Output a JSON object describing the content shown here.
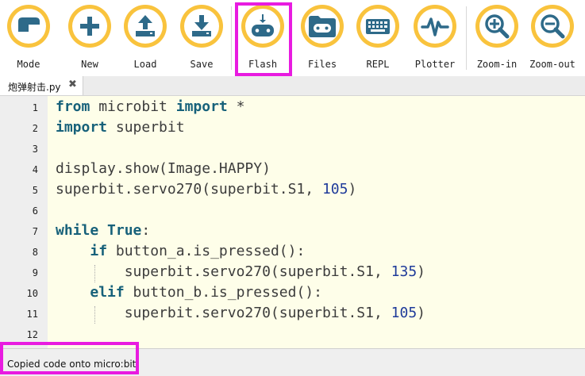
{
  "toolbar": {
    "buttons": [
      {
        "label": "Mode",
        "icon": "mode-icon"
      },
      {
        "label": "New",
        "icon": "plus-icon"
      },
      {
        "label": "Load",
        "icon": "upload-icon"
      },
      {
        "label": "Save",
        "icon": "download-icon"
      },
      {
        "label": "Flash",
        "icon": "flash-icon"
      },
      {
        "label": "Files",
        "icon": "files-icon"
      },
      {
        "label": "REPL",
        "icon": "keyboard-icon"
      },
      {
        "label": "Plotter",
        "icon": "plotter-icon"
      },
      {
        "label": "Zoom-in",
        "icon": "zoom-in-icon"
      },
      {
        "label": "Zoom-out",
        "icon": "zoom-out-icon"
      }
    ],
    "accent_color": "#f9c33d",
    "icon_color": "#2e6a89",
    "highlight_color": "#e81be0"
  },
  "tab": {
    "label": "炮弹射击.py",
    "close_glyph": "✖"
  },
  "editor": {
    "line_numbers": [
      "1",
      "2",
      "3",
      "4",
      "5",
      "6",
      "7",
      "8",
      "9",
      "10",
      "11",
      "12"
    ],
    "lines": [
      [
        {
          "t": "from",
          "k": "kw"
        },
        {
          "t": " microbit "
        },
        {
          "t": "import",
          "k": "kw"
        },
        {
          "t": " *"
        }
      ],
      [
        {
          "t": "import",
          "k": "kw"
        },
        {
          "t": " superbit"
        }
      ],
      [],
      [
        {
          "t": "display.show(Image.HAPPY)"
        }
      ],
      [
        {
          "t": "superbit.servo270(superbit.S1, "
        },
        {
          "t": "105",
          "k": "num"
        },
        {
          "t": ")"
        }
      ],
      [],
      [
        {
          "t": "while",
          "k": "kw"
        },
        {
          "t": " "
        },
        {
          "t": "True",
          "k": "kw"
        },
        {
          "t": ":"
        }
      ],
      [
        {
          "t": "    "
        },
        {
          "t": "if",
          "k": "kw"
        },
        {
          "t": " button_a.is_pressed():"
        }
      ],
      [
        {
          "t": "        superbit.servo270(superbit.S1, "
        },
        {
          "t": "135",
          "k": "num"
        },
        {
          "t": ")"
        }
      ],
      [
        {
          "t": "    "
        },
        {
          "t": "elif",
          "k": "kw"
        },
        {
          "t": " button_b.is_pressed():"
        }
      ],
      [
        {
          "t": "        superbit.servo270(superbit.S1, "
        },
        {
          "t": "105",
          "k": "num"
        },
        {
          "t": ")"
        }
      ],
      []
    ],
    "background": "#fefee9",
    "keyword_color": "#17617a",
    "number_color": "#1f3b9a"
  },
  "status": {
    "text": "Copied code onto micro:bit."
  }
}
